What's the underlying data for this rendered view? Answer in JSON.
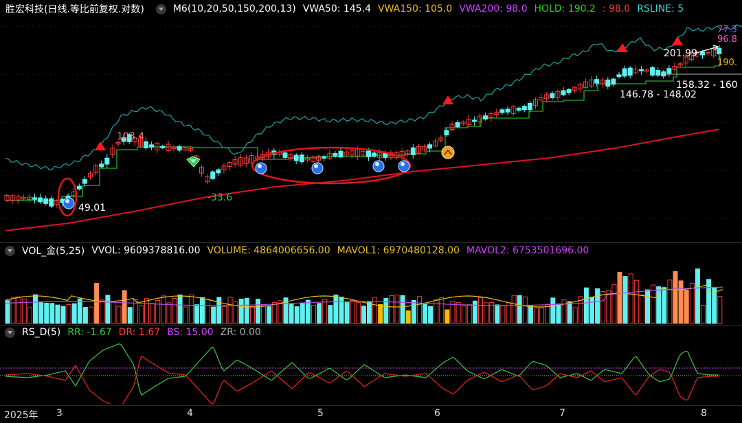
{
  "main_header": {
    "title": "胜宏科技(日线.等比前复权.对数)",
    "indicator": "M6(10,20,50,150,200,13)",
    "vwa50": "VWA50: 145.4",
    "vwa150": "VWA150: 105.0",
    "vwa200": "VWA200: 98.0",
    "hold": "HOLD: 190.2",
    "sep": ": 98.0",
    "rsline": "RSLINE: 5"
  },
  "price_labels": {
    "high1": "103.4",
    "low1": "-33.6",
    "low0": "49.01",
    "right1": "77.3",
    "right2": "96.8",
    "right3": "190.",
    "range_top": "201.99",
    "range1": "158.32 - 160",
    "range2": "146.78 - 148.02"
  },
  "vol_header": {
    "title": "VOL_金(5,25)",
    "vvol": "VVOL: 9609378816.00",
    "volume": "VOLUME: 4864006656.00",
    "mavol1": "MAVOL1: 6970480128.00",
    "mavol2": "MAVOL2: 6753501696.00"
  },
  "rs_header": {
    "title": "RS_D(5)",
    "rr": "RR: -1.67",
    "dr": "DR: 1.67",
    "bs": "BS: 15.00",
    "zr": "ZR: 0.00"
  },
  "x_axis": {
    "year": "2025年",
    "months": [
      "3",
      "4",
      "5",
      "6",
      "7",
      "8"
    ]
  },
  "colors": {
    "up": "#ff3b3b",
    "down": "#5ff0f0",
    "cyan_line": "#1a9a9a",
    "red_line": "#e0102a",
    "green_line": "#22b422",
    "orange_vol": "#ff8c50",
    "yellow_vol": "#f0c000",
    "mavol1": "#e8c020",
    "mavol2": "#b050e0",
    "rr_line": "#3bb83b",
    "dr_line": "#e02020",
    "bs_line": "#d040ff"
  }
}
